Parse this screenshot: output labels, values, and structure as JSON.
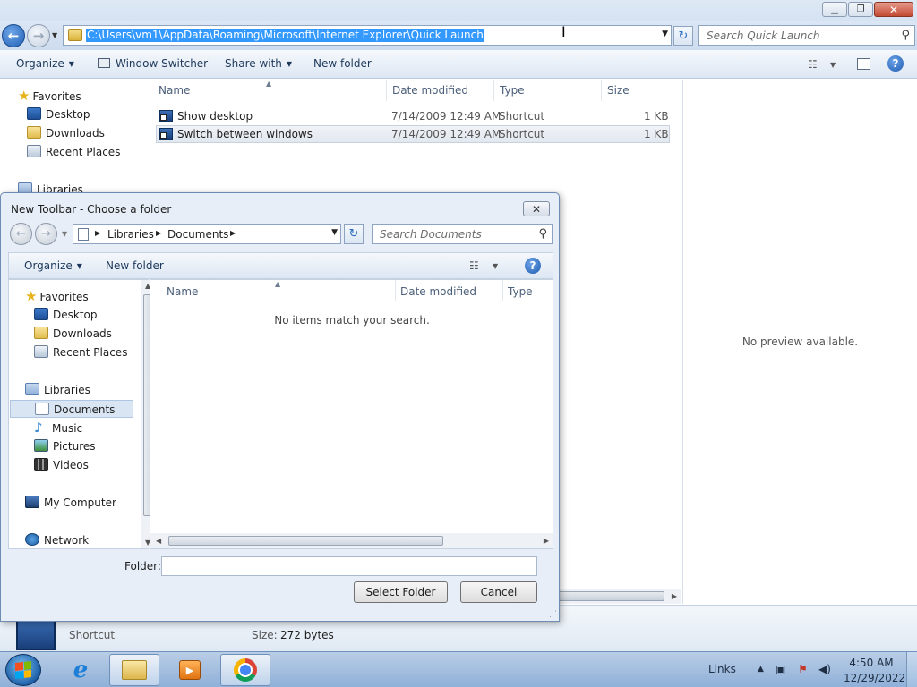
{
  "explorer": {
    "address_path": "C:\\Users\\vm1\\AppData\\Roaming\\Microsoft\\Internet Explorer\\Quick Launch",
    "search_placeholder": "Search Quick Launch",
    "commands": {
      "organize": "Organize",
      "window_switcher": "Window Switcher",
      "share_with": "Share with",
      "new_folder": "New folder"
    },
    "nav_pane": {
      "favorites": "Favorites",
      "desktop": "Desktop",
      "downloads": "Downloads",
      "recent_places": "Recent Places",
      "libraries": "Libraries"
    },
    "columns": {
      "name": "Name",
      "date_modified": "Date modified",
      "type": "Type",
      "size": "Size"
    },
    "files": [
      {
        "name": "Show desktop",
        "date": "7/14/2009 12:49 AM",
        "type": "Shortcut",
        "size": "1 KB"
      },
      {
        "name": "Switch between windows",
        "date": "7/14/2009 12:49 AM",
        "type": "Shortcut",
        "size": "1 KB"
      }
    ],
    "preview_text": "No preview available.",
    "details": {
      "type": "Shortcut",
      "size_label": "Size:",
      "size_value": "272 bytes"
    }
  },
  "dialog": {
    "title": "New Toolbar - Choose a folder",
    "close_glyph": "✕",
    "breadcrumb": [
      "Libraries",
      "Documents"
    ],
    "search_placeholder": "Search Documents",
    "commands": {
      "organize": "Organize",
      "new_folder": "New folder"
    },
    "nav_pane": {
      "favorites": "Favorites",
      "desktop": "Desktop",
      "downloads": "Downloads",
      "recent_places": "Recent Places",
      "libraries": "Libraries",
      "documents": "Documents",
      "music": "Music",
      "pictures": "Pictures",
      "videos": "Videos",
      "my_computer": "My Computer",
      "network": "Network"
    },
    "columns": {
      "name": "Name",
      "date_modified": "Date modified",
      "type": "Type"
    },
    "empty_message": "No items match your search.",
    "folder_label": "Folder:",
    "folder_value": "",
    "select_button": "Select Folder",
    "cancel_button": "Cancel"
  },
  "taskbar": {
    "links_label": "Links",
    "time": "4:50 AM",
    "date": "12/29/2022"
  },
  "icons": {
    "back": "←",
    "forward": "→",
    "refresh": "↻",
    "search": "⚲",
    "help": "?",
    "star": "★",
    "music_note": "♪"
  },
  "colors": {
    "selection": "#3399ff",
    "chrome_bg": "#dbe6f4",
    "dialog_bg": "#e7eef7"
  }
}
